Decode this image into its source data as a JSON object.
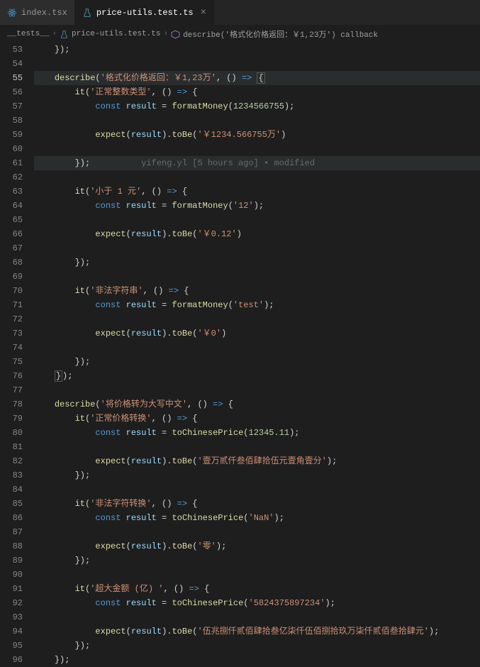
{
  "tabs": {
    "inactive": {
      "label": "index.tsx",
      "icon_color": "#4a9fd8"
    },
    "active": {
      "label": "price-utils.test.ts",
      "icon_color": "#519aba"
    }
  },
  "breadcrumb": {
    "folder": "__tests__",
    "file": "price-utils.test.ts",
    "symbol_prefix": "describe",
    "symbol": "('格式化价格返回：￥1,23万') callback"
  },
  "gutter_start": 53,
  "lines": [
    {
      "n": 53,
      "ind": 1,
      "t": [
        {
          "c": "pun",
          "v": "});"
        }
      ]
    },
    {
      "n": 54,
      "ind": 0,
      "t": []
    },
    {
      "n": 55,
      "ind": 1,
      "hl": true,
      "active": true,
      "t": [
        {
          "c": "fn",
          "v": "describe"
        },
        {
          "c": "pun",
          "v": "("
        },
        {
          "c": "str",
          "v": "'格式化价格返回：￥1,23万'"
        },
        {
          "c": "pun",
          "v": ", "
        },
        {
          "c": "pun",
          "v": "()"
        },
        {
          "c": "op",
          "v": " "
        },
        {
          "c": "arrow",
          "v": "=>"
        },
        {
          "c": "op",
          "v": " "
        },
        {
          "c": "pun",
          "v": "{",
          "box": true
        }
      ]
    },
    {
      "n": 56,
      "ind": 2,
      "t": [
        {
          "c": "fn",
          "v": "it"
        },
        {
          "c": "pun",
          "v": "("
        },
        {
          "c": "str",
          "v": "'正常整数类型'"
        },
        {
          "c": "pun",
          "v": ", "
        },
        {
          "c": "pun",
          "v": "()"
        },
        {
          "c": "op",
          "v": " "
        },
        {
          "c": "arrow",
          "v": "=>"
        },
        {
          "c": "op",
          "v": " "
        },
        {
          "c": "pun",
          "v": "{"
        }
      ]
    },
    {
      "n": 57,
      "ind": 3,
      "t": [
        {
          "c": "const",
          "v": "const"
        },
        {
          "c": "op",
          "v": " "
        },
        {
          "c": "var",
          "v": "result"
        },
        {
          "c": "op",
          "v": " = "
        },
        {
          "c": "fn",
          "v": "formatMoney"
        },
        {
          "c": "pun",
          "v": "("
        },
        {
          "c": "num",
          "v": "1234566755"
        },
        {
          "c": "pun",
          "v": ");"
        }
      ]
    },
    {
      "n": 58,
      "ind": 0,
      "t": []
    },
    {
      "n": 59,
      "ind": 3,
      "t": [
        {
          "c": "fn",
          "v": "expect"
        },
        {
          "c": "pun",
          "v": "("
        },
        {
          "c": "var",
          "v": "result"
        },
        {
          "c": "pun",
          "v": ")."
        },
        {
          "c": "fn",
          "v": "toBe"
        },
        {
          "c": "pun",
          "v": "("
        },
        {
          "c": "str",
          "v": "'￥1234.566755万'"
        },
        {
          "c": "pun",
          "v": ")"
        }
      ]
    },
    {
      "n": 60,
      "ind": 0,
      "t": []
    },
    {
      "n": 61,
      "ind": 2,
      "hl": true,
      "t": [
        {
          "c": "pun",
          "v": "});"
        },
        {
          "c": "lens",
          "v": "          yifeng.yl [5 hours ago] • modified"
        }
      ]
    },
    {
      "n": 62,
      "ind": 0,
      "t": []
    },
    {
      "n": 63,
      "ind": 2,
      "t": [
        {
          "c": "fn",
          "v": "it"
        },
        {
          "c": "pun",
          "v": "("
        },
        {
          "c": "str",
          "v": "'小于 1 元'"
        },
        {
          "c": "pun",
          "v": ", "
        },
        {
          "c": "pun",
          "v": "()"
        },
        {
          "c": "op",
          "v": " "
        },
        {
          "c": "arrow",
          "v": "=>"
        },
        {
          "c": "op",
          "v": " "
        },
        {
          "c": "pun",
          "v": "{"
        }
      ]
    },
    {
      "n": 64,
      "ind": 3,
      "t": [
        {
          "c": "const",
          "v": "const"
        },
        {
          "c": "op",
          "v": " "
        },
        {
          "c": "var",
          "v": "result"
        },
        {
          "c": "op",
          "v": " = "
        },
        {
          "c": "fn",
          "v": "formatMoney"
        },
        {
          "c": "pun",
          "v": "("
        },
        {
          "c": "str",
          "v": "'12'"
        },
        {
          "c": "pun",
          "v": ");"
        }
      ]
    },
    {
      "n": 65,
      "ind": 0,
      "t": []
    },
    {
      "n": 66,
      "ind": 3,
      "t": [
        {
          "c": "fn",
          "v": "expect"
        },
        {
          "c": "pun",
          "v": "("
        },
        {
          "c": "var",
          "v": "result"
        },
        {
          "c": "pun",
          "v": ")."
        },
        {
          "c": "fn",
          "v": "toBe"
        },
        {
          "c": "pun",
          "v": "("
        },
        {
          "c": "str",
          "v": "'￥0.12'"
        },
        {
          "c": "pun",
          "v": ")"
        }
      ]
    },
    {
      "n": 67,
      "ind": 0,
      "t": []
    },
    {
      "n": 68,
      "ind": 2,
      "t": [
        {
          "c": "pun",
          "v": "});"
        }
      ]
    },
    {
      "n": 69,
      "ind": 0,
      "t": []
    },
    {
      "n": 70,
      "ind": 2,
      "t": [
        {
          "c": "fn",
          "v": "it"
        },
        {
          "c": "pun",
          "v": "("
        },
        {
          "c": "str",
          "v": "'非法字符串'"
        },
        {
          "c": "pun",
          "v": ", "
        },
        {
          "c": "pun",
          "v": "()"
        },
        {
          "c": "op",
          "v": " "
        },
        {
          "c": "arrow",
          "v": "=>"
        },
        {
          "c": "op",
          "v": " "
        },
        {
          "c": "pun",
          "v": "{"
        }
      ]
    },
    {
      "n": 71,
      "ind": 3,
      "t": [
        {
          "c": "const",
          "v": "const"
        },
        {
          "c": "op",
          "v": " "
        },
        {
          "c": "var",
          "v": "result"
        },
        {
          "c": "op",
          "v": " = "
        },
        {
          "c": "fn",
          "v": "formatMoney"
        },
        {
          "c": "pun",
          "v": "("
        },
        {
          "c": "str",
          "v": "'test'"
        },
        {
          "c": "pun",
          "v": ");"
        }
      ]
    },
    {
      "n": 72,
      "ind": 0,
      "t": []
    },
    {
      "n": 73,
      "ind": 3,
      "t": [
        {
          "c": "fn",
          "v": "expect"
        },
        {
          "c": "pun",
          "v": "("
        },
        {
          "c": "var",
          "v": "result"
        },
        {
          "c": "pun",
          "v": ")."
        },
        {
          "c": "fn",
          "v": "toBe"
        },
        {
          "c": "pun",
          "v": "("
        },
        {
          "c": "str",
          "v": "'￥0'"
        },
        {
          "c": "pun",
          "v": ")"
        }
      ]
    },
    {
      "n": 74,
      "ind": 0,
      "t": []
    },
    {
      "n": 75,
      "ind": 2,
      "t": [
        {
          "c": "pun",
          "v": "});"
        }
      ]
    },
    {
      "n": 76,
      "ind": 1,
      "t": [
        {
          "c": "pun",
          "v": "}",
          "box": true
        },
        {
          "c": "pun",
          "v": ");"
        }
      ]
    },
    {
      "n": 77,
      "ind": 0,
      "t": []
    },
    {
      "n": 78,
      "ind": 1,
      "t": [
        {
          "c": "fn",
          "v": "describe"
        },
        {
          "c": "pun",
          "v": "("
        },
        {
          "c": "str",
          "v": "'将价格转为大写中文'"
        },
        {
          "c": "pun",
          "v": ", "
        },
        {
          "c": "pun",
          "v": "()"
        },
        {
          "c": "op",
          "v": " "
        },
        {
          "c": "arrow",
          "v": "=>"
        },
        {
          "c": "op",
          "v": " "
        },
        {
          "c": "pun",
          "v": "{"
        }
      ]
    },
    {
      "n": 79,
      "ind": 2,
      "t": [
        {
          "c": "fn",
          "v": "it"
        },
        {
          "c": "pun",
          "v": "("
        },
        {
          "c": "str",
          "v": "'正常价格转换'"
        },
        {
          "c": "pun",
          "v": ", "
        },
        {
          "c": "pun",
          "v": "()"
        },
        {
          "c": "op",
          "v": " "
        },
        {
          "c": "arrow",
          "v": "=>"
        },
        {
          "c": "op",
          "v": " "
        },
        {
          "c": "pun",
          "v": "{"
        }
      ]
    },
    {
      "n": 80,
      "ind": 3,
      "t": [
        {
          "c": "const",
          "v": "const"
        },
        {
          "c": "op",
          "v": " "
        },
        {
          "c": "var",
          "v": "result"
        },
        {
          "c": "op",
          "v": " = "
        },
        {
          "c": "fn",
          "v": "toChinesePrice"
        },
        {
          "c": "pun",
          "v": "("
        },
        {
          "c": "num",
          "v": "12345.11"
        },
        {
          "c": "pun",
          "v": ");"
        }
      ]
    },
    {
      "n": 81,
      "ind": 0,
      "t": []
    },
    {
      "n": 82,
      "ind": 3,
      "t": [
        {
          "c": "fn",
          "v": "expect"
        },
        {
          "c": "pun",
          "v": "("
        },
        {
          "c": "var",
          "v": "result"
        },
        {
          "c": "pun",
          "v": ")."
        },
        {
          "c": "fn",
          "v": "toBe"
        },
        {
          "c": "pun",
          "v": "("
        },
        {
          "c": "str",
          "v": "'壹万贰仟叁佰肆拾伍元壹角壹分'"
        },
        {
          "c": "pun",
          "v": ");"
        }
      ]
    },
    {
      "n": 83,
      "ind": 2,
      "t": [
        {
          "c": "pun",
          "v": "});"
        }
      ]
    },
    {
      "n": 84,
      "ind": 0,
      "t": []
    },
    {
      "n": 85,
      "ind": 2,
      "t": [
        {
          "c": "fn",
          "v": "it"
        },
        {
          "c": "pun",
          "v": "("
        },
        {
          "c": "str",
          "v": "'非法字符转换'"
        },
        {
          "c": "pun",
          "v": ", "
        },
        {
          "c": "pun",
          "v": "()"
        },
        {
          "c": "op",
          "v": " "
        },
        {
          "c": "arrow",
          "v": "=>"
        },
        {
          "c": "op",
          "v": " "
        },
        {
          "c": "pun",
          "v": "{"
        }
      ]
    },
    {
      "n": 86,
      "ind": 3,
      "t": [
        {
          "c": "const",
          "v": "const"
        },
        {
          "c": "op",
          "v": " "
        },
        {
          "c": "var",
          "v": "result"
        },
        {
          "c": "op",
          "v": " = "
        },
        {
          "c": "fn",
          "v": "toChinesePrice"
        },
        {
          "c": "pun",
          "v": "("
        },
        {
          "c": "str",
          "v": "'NaN'"
        },
        {
          "c": "pun",
          "v": ");"
        }
      ]
    },
    {
      "n": 87,
      "ind": 0,
      "t": []
    },
    {
      "n": 88,
      "ind": 3,
      "t": [
        {
          "c": "fn",
          "v": "expect"
        },
        {
          "c": "pun",
          "v": "("
        },
        {
          "c": "var",
          "v": "result"
        },
        {
          "c": "pun",
          "v": ")."
        },
        {
          "c": "fn",
          "v": "toBe"
        },
        {
          "c": "pun",
          "v": "("
        },
        {
          "c": "str",
          "v": "'零'"
        },
        {
          "c": "pun",
          "v": ");"
        }
      ]
    },
    {
      "n": 89,
      "ind": 2,
      "t": [
        {
          "c": "pun",
          "v": "});"
        }
      ]
    },
    {
      "n": 90,
      "ind": 0,
      "t": []
    },
    {
      "n": 91,
      "ind": 2,
      "t": [
        {
          "c": "fn",
          "v": "it"
        },
        {
          "c": "pun",
          "v": "("
        },
        {
          "c": "str",
          "v": "'超大金额 (亿) '"
        },
        {
          "c": "pun",
          "v": ", "
        },
        {
          "c": "pun",
          "v": "()"
        },
        {
          "c": "op",
          "v": " "
        },
        {
          "c": "arrow",
          "v": "=>"
        },
        {
          "c": "op",
          "v": " "
        },
        {
          "c": "pun",
          "v": "{"
        }
      ]
    },
    {
      "n": 92,
      "ind": 3,
      "t": [
        {
          "c": "const",
          "v": "const"
        },
        {
          "c": "op",
          "v": " "
        },
        {
          "c": "var",
          "v": "result"
        },
        {
          "c": "op",
          "v": " = "
        },
        {
          "c": "fn",
          "v": "toChinesePrice"
        },
        {
          "c": "pun",
          "v": "("
        },
        {
          "c": "str",
          "v": "'5824375897234'"
        },
        {
          "c": "pun",
          "v": ");"
        }
      ]
    },
    {
      "n": 93,
      "ind": 0,
      "t": []
    },
    {
      "n": 94,
      "ind": 3,
      "t": [
        {
          "c": "fn",
          "v": "expect"
        },
        {
          "c": "pun",
          "v": "("
        },
        {
          "c": "var",
          "v": "result"
        },
        {
          "c": "pun",
          "v": ")."
        },
        {
          "c": "fn",
          "v": "toBe"
        },
        {
          "c": "pun",
          "v": "("
        },
        {
          "c": "str",
          "v": "'伍兆捌仟贰佰肆拾叁亿柒仟伍佰捌拾玖万柒仟贰佰叁拾肆元'"
        },
        {
          "c": "pun",
          "v": ");"
        }
      ]
    },
    {
      "n": 95,
      "ind": 2,
      "t": [
        {
          "c": "pun",
          "v": "});"
        }
      ]
    },
    {
      "n": 96,
      "ind": 1,
      "t": [
        {
          "c": "pun",
          "v": "});"
        }
      ]
    }
  ]
}
